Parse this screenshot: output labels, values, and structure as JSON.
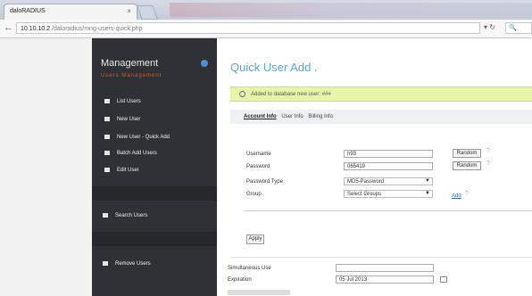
{
  "browser": {
    "tab_title": "daloRADIUS",
    "url": "10.10.10.2",
    "url_rest": " /daloradius/mng-users-quick.php"
  },
  "sidebar": {
    "title": "Management",
    "subtitle": "Users Management",
    "items": [
      {
        "label": "List Users"
      },
      {
        "label": "New User"
      },
      {
        "label": "New User - Quick Add"
      },
      {
        "label": "Batch Add Users"
      },
      {
        "label": "Edit User"
      },
      {
        "label": "Search Users"
      },
      {
        "label": "Remove Users"
      }
    ]
  },
  "main": {
    "title": "Quick User Add .",
    "notice": "Added to database new user: ###",
    "sections": {
      "active": "Account Info",
      "others": [
        "User Info",
        "Billing Info"
      ]
    },
    "form": {
      "username_label": "Username",
      "username_value": "h93",
      "password_label": "Password",
      "password_value": "065419",
      "random_label": "Random",
      "password_type_label": "Password Type",
      "password_type_value": "MD5-Password",
      "group_label": "Group",
      "group_value": "Select Groups",
      "add_label": "Add",
      "apply_label": "Apply",
      "simult_label": "Simultaneous Use",
      "expiration_label": "Expiration",
      "expiration_value": "05 Jul 2013"
    }
  }
}
